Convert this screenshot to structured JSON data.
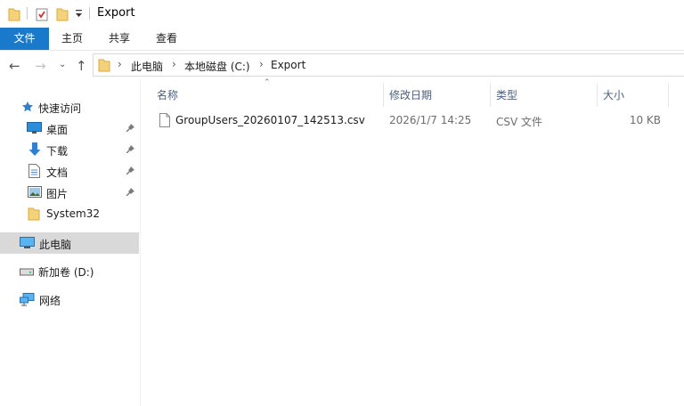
{
  "window": {
    "title": "Export"
  },
  "ribbon": {
    "tabs": [
      "文件",
      "主页",
      "共享",
      "查看"
    ]
  },
  "address": {
    "segments": [
      "此电脑",
      "本地磁盘 (C:)",
      "Export"
    ]
  },
  "sidebar": {
    "quick_access": "快速访问",
    "items": [
      {
        "label": "桌面",
        "icon": "desktop-icon",
        "pinned": true
      },
      {
        "label": "下载",
        "icon": "download-icon",
        "pinned": true
      },
      {
        "label": "文档",
        "icon": "document-icon",
        "pinned": true
      },
      {
        "label": "图片",
        "icon": "picture-icon",
        "pinned": true
      },
      {
        "label": "System32",
        "icon": "folder-icon",
        "pinned": false
      }
    ],
    "this_pc": "此电脑",
    "drive": "新加卷 (D:)",
    "network": "网络"
  },
  "columns": {
    "name": "名称",
    "modified": "修改日期",
    "type": "类型",
    "size": "大小"
  },
  "files": [
    {
      "name": "GroupUsers_20260107_142513.csv",
      "modified": "2026/1/7 14:25",
      "type": "CSV 文件",
      "size": "10 KB"
    }
  ],
  "colors": {
    "accent": "#1979ca",
    "folder": "#f4d27a",
    "selected": "#d9d9d9"
  }
}
